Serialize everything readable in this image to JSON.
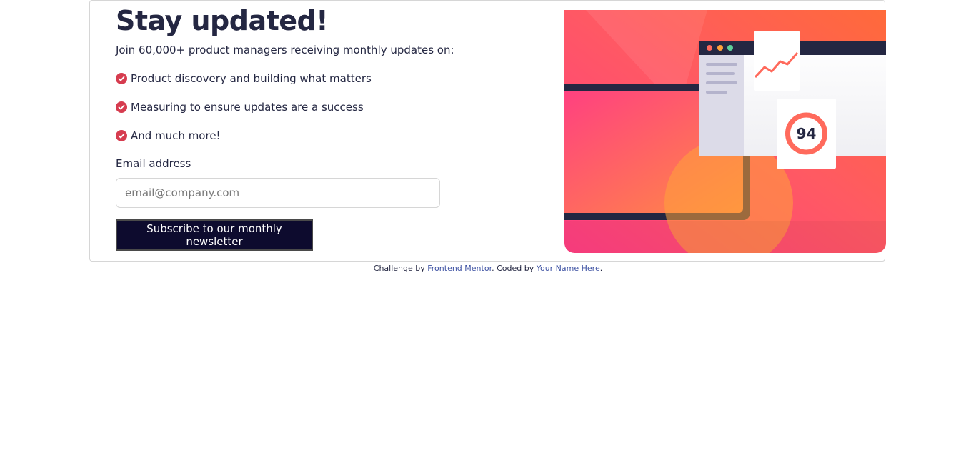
{
  "heading": "Stay updated!",
  "intro": "Join 60,000+ product managers receiving monthly updates on:",
  "features": [
    "Product discovery and building what matters",
    "Measuring to ensure updates are a success",
    "And much more!"
  ],
  "form": {
    "email_label": "Email address",
    "email_placeholder": "email@company.com",
    "email_value": "",
    "submit_label": "Subscribe to our monthly newsletter"
  },
  "illustration": {
    "score": "94",
    "icon": "dashboard-illustration"
  },
  "footer": {
    "prefix": "Challenge by ",
    "link1": "Frontend Mentor",
    "middle": ". Coded by ",
    "link2": "Your Name Here",
    "suffix": "."
  },
  "colors": {
    "accent_dark": "#242742",
    "button_bg": "#0d0b2e",
    "check_red": "#d63c4f",
    "gradient_pink": "#ff3e82",
    "gradient_orange": "#ff6a3a"
  }
}
